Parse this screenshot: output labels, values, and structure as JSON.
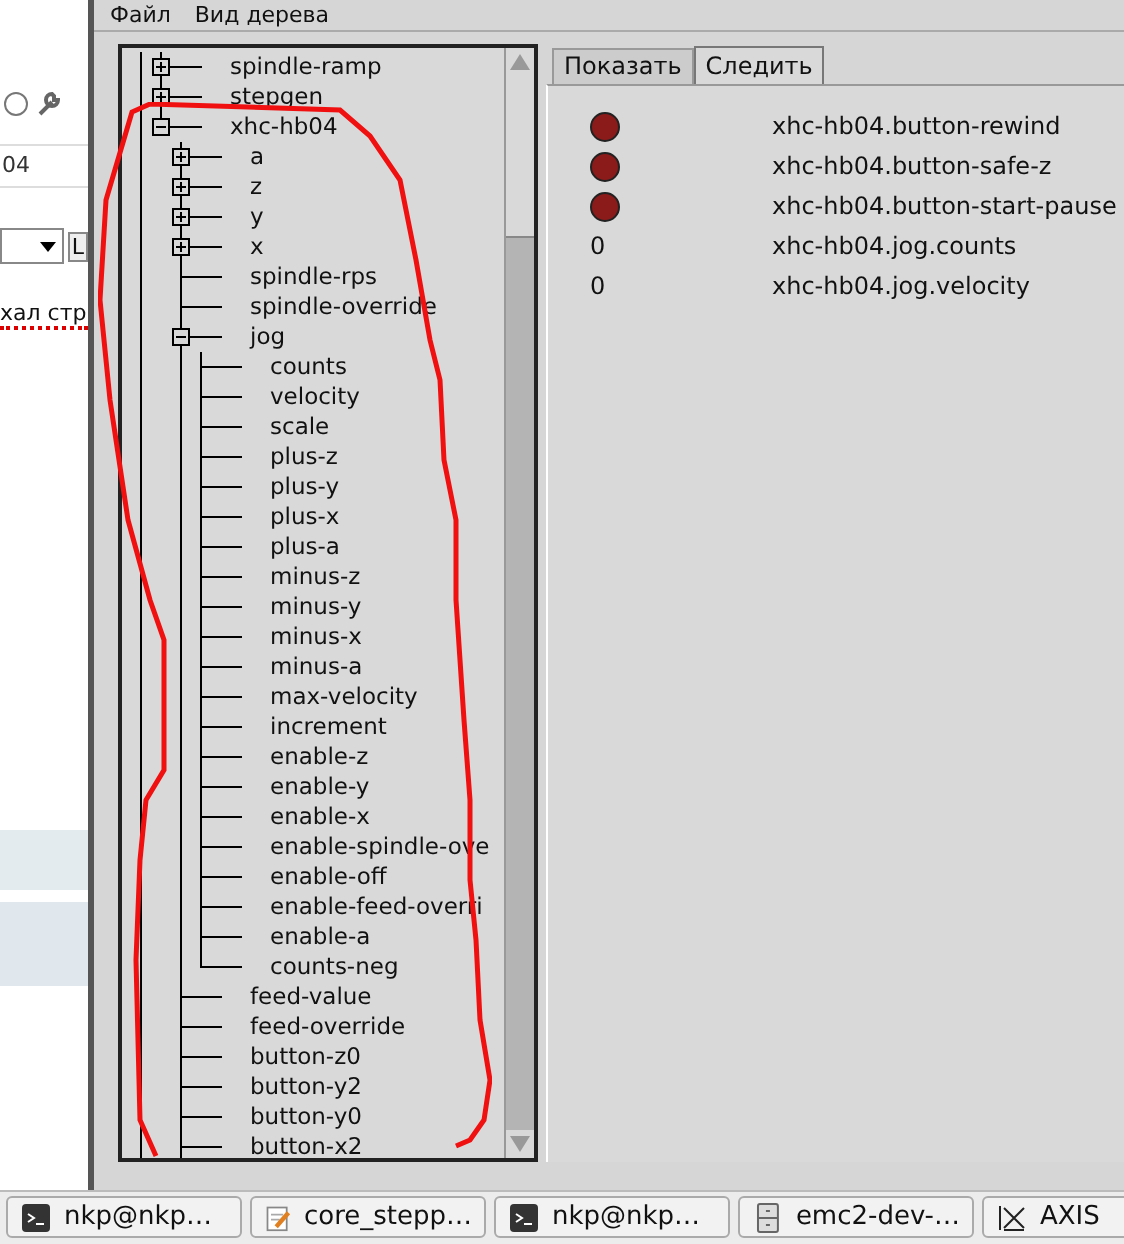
{
  "window": {
    "menu": [
      "Файл",
      "Вид дерева"
    ]
  },
  "background_window": {
    "field_value": "04",
    "button": "L",
    "text": "хал стр"
  },
  "tree": {
    "items": [
      {
        "label": "spindle-ramp",
        "expanded": false
      },
      {
        "label": "stepgen",
        "expanded": false
      },
      {
        "label": "xhc-hb04",
        "expanded": true,
        "children": [
          {
            "label": "a",
            "expanded": false
          },
          {
            "label": "z",
            "expanded": false
          },
          {
            "label": "y",
            "expanded": false
          },
          {
            "label": "x",
            "expanded": false
          },
          {
            "label": "spindle-rps"
          },
          {
            "label": "spindle-override"
          },
          {
            "label": "jog",
            "expanded": true,
            "children": [
              {
                "label": "counts"
              },
              {
                "label": "velocity"
              },
              {
                "label": "scale"
              },
              {
                "label": "plus-z"
              },
              {
                "label": "plus-y"
              },
              {
                "label": "plus-x"
              },
              {
                "label": "plus-a"
              },
              {
                "label": "minus-z"
              },
              {
                "label": "minus-y"
              },
              {
                "label": "minus-x"
              },
              {
                "label": "minus-a"
              },
              {
                "label": "max-velocity"
              },
              {
                "label": "increment"
              },
              {
                "label": "enable-z"
              },
              {
                "label": "enable-y"
              },
              {
                "label": "enable-x"
              },
              {
                "label": "enable-spindle-ove"
              },
              {
                "label": "enable-off"
              },
              {
                "label": "enable-feed-overri"
              },
              {
                "label": "enable-a"
              },
              {
                "label": "counts-neg"
              }
            ]
          },
          {
            "label": "feed-value"
          },
          {
            "label": "feed-override"
          },
          {
            "label": "button-z0"
          },
          {
            "label": "button-y2"
          },
          {
            "label": "button-y0"
          },
          {
            "label": "button-x2"
          }
        ]
      }
    ]
  },
  "tabs": [
    {
      "label": "Показать",
      "selected": false
    },
    {
      "label": "Следить",
      "selected": true
    }
  ],
  "watch": [
    {
      "kind": "bit",
      "on": false,
      "name": "xhc-hb04.button-rewind"
    },
    {
      "kind": "bit",
      "on": false,
      "name": "xhc-hb04.button-safe-z"
    },
    {
      "kind": "bit",
      "on": false,
      "name": "xhc-hb04.button-start-pause"
    },
    {
      "kind": "value",
      "value": "0",
      "name": "xhc-hb04.jog.counts"
    },
    {
      "kind": "value",
      "value": "0",
      "name": "xhc-hb04.jog.velocity"
    }
  ],
  "taskbar": [
    {
      "kind": "terminal",
      "label": "nkp@nkp…"
    },
    {
      "kind": "editor",
      "label": "core_stepp…"
    },
    {
      "kind": "terminal",
      "label": "nkp@nkp…"
    },
    {
      "kind": "cabinet",
      "label": "emc2-dev-…"
    },
    {
      "kind": "axis",
      "label": "AXIS"
    }
  ]
}
